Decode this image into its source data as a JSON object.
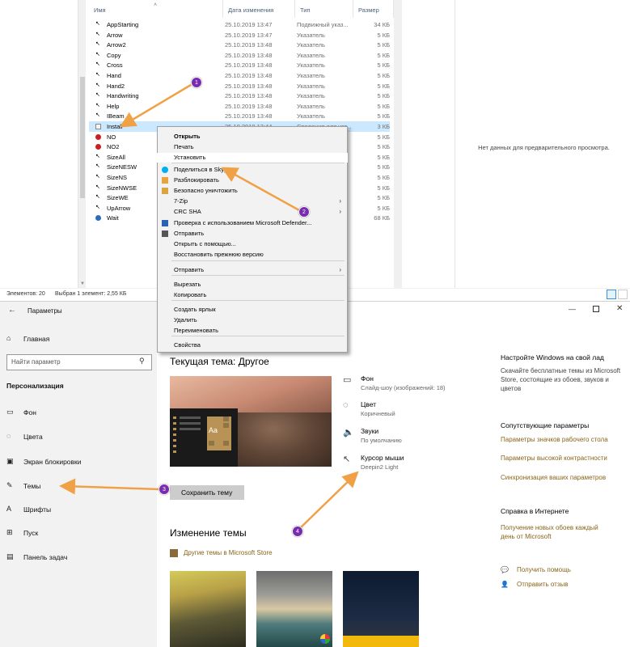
{
  "explorer": {
    "columns": {
      "name": "Имя",
      "date": "Дата изменения",
      "type": "Тип",
      "size": "Размер"
    },
    "files": [
      {
        "name": "AppStarting",
        "date": "25.10.2019 13:47",
        "type": "Подвижный указ...",
        "size": "34 КБ",
        "icon": "cursor-icon"
      },
      {
        "name": "Arrow",
        "date": "25.10.2019 13:47",
        "type": "Указатель",
        "size": "5 КБ",
        "icon": "cursor-icon"
      },
      {
        "name": "Arrow2",
        "date": "25.10.2019 13:48",
        "type": "Указатель",
        "size": "5 КБ",
        "icon": "cursor-icon"
      },
      {
        "name": "Copy",
        "date": "25.10.2019 13:48",
        "type": "Указатель",
        "size": "5 КБ",
        "icon": "cursor-icon"
      },
      {
        "name": "Cross",
        "date": "25.10.2019 13:48",
        "type": "Указатель",
        "size": "5 КБ",
        "icon": "cross-icon"
      },
      {
        "name": "Hand",
        "date": "25.10.2019 13:48",
        "type": "Указатель",
        "size": "5 КБ",
        "icon": "hand-icon"
      },
      {
        "name": "Hand2",
        "date": "25.10.2019 13:48",
        "type": "Указатель",
        "size": "5 КБ",
        "icon": "hand-icon"
      },
      {
        "name": "Handwriting",
        "date": "25.10.2019 13:48",
        "type": "Указатель",
        "size": "5 КБ",
        "icon": "pen-icon"
      },
      {
        "name": "Help",
        "date": "25.10.2019 13:48",
        "type": "Указатель",
        "size": "5 КБ",
        "icon": "cursor-icon"
      },
      {
        "name": "IBeam",
        "date": "25.10.2019 13:48",
        "type": "Указатель",
        "size": "5 КБ",
        "icon": "ibeam-icon"
      },
      {
        "name": "Install",
        "date": "25.10.2019 13:44",
        "type": "Сведения для уст...",
        "size": "3 КБ",
        "icon": "settings-file-icon"
      },
      {
        "name": "NO",
        "date": "",
        "type": "",
        "size": "5 КБ",
        "icon": "no-icon"
      },
      {
        "name": "NO2",
        "date": "",
        "type": "",
        "size": "5 КБ",
        "icon": "no-icon"
      },
      {
        "name": "SizeAll",
        "date": "",
        "type": "",
        "size": "5 КБ",
        "icon": "move-icon"
      },
      {
        "name": "SizeNESW",
        "date": "",
        "type": "",
        "size": "5 КБ",
        "icon": "resize-icon"
      },
      {
        "name": "SizeNS",
        "date": "",
        "type": "",
        "size": "5 КБ",
        "icon": "resize-icon"
      },
      {
        "name": "SizeNWSE",
        "date": "",
        "type": "",
        "size": "5 КБ",
        "icon": "resize-icon"
      },
      {
        "name": "SizeWE",
        "date": "",
        "type": "",
        "size": "5 КБ",
        "icon": "resize-icon"
      },
      {
        "name": "UpArrow",
        "date": "",
        "type": "",
        "size": "5 КБ",
        "icon": "cursor-icon"
      },
      {
        "name": "Wait",
        "date": "",
        "type": "",
        "size": "68 КБ",
        "icon": "wait-icon"
      }
    ],
    "selected_index": 10,
    "preview_message": "Нет данных для предварительного просмотра.",
    "status": {
      "count": "Элементов: 20",
      "selection": "Выбран 1 элемент: 2,55 КБ"
    }
  },
  "context_menu": {
    "items": [
      {
        "label": "Открыть",
        "bold": true
      },
      {
        "label": "Печать"
      },
      {
        "label": "Установить",
        "hover": true
      },
      {
        "label": "Поделиться в Skype",
        "icon": "skype-icon"
      },
      {
        "label": "Разблокировать",
        "icon": "unlock-icon"
      },
      {
        "label": "Безопасно уничтожить",
        "icon": "shred-icon"
      },
      {
        "label": "7-Zip",
        "submenu": true
      },
      {
        "label": "CRC SHA",
        "submenu": true
      },
      {
        "label": "Проверка с использованием Microsoft Defender...",
        "icon": "defender-icon"
      },
      {
        "label": "Отправить",
        "icon": "share-icon"
      },
      {
        "label": "Открыть с помощью..."
      },
      {
        "label": "Восстановить прежнюю версию"
      },
      {
        "label": "Отправить",
        "submenu": true
      },
      {
        "label": "Вырезать"
      },
      {
        "label": "Копировать"
      },
      {
        "label": "Создать ярлык"
      },
      {
        "label": "Удалить"
      },
      {
        "label": "Переименовать"
      },
      {
        "label": "Свойства"
      }
    ]
  },
  "settings": {
    "title": "Параметры",
    "home": "Главная",
    "search_placeholder": "Найти параметр",
    "section": "Персонализация",
    "nav": [
      {
        "label": "Фон",
        "icon": "image-icon"
      },
      {
        "label": "Цвета",
        "icon": "palette-icon"
      },
      {
        "label": "Экран блокировки",
        "icon": "lockscreen-icon"
      },
      {
        "label": "Темы",
        "icon": "themes-icon",
        "active": true
      },
      {
        "label": "Шрифты",
        "icon": "font-icon"
      },
      {
        "label": "Пуск",
        "icon": "start-icon"
      },
      {
        "label": "Панель задач",
        "icon": "taskbar-icon"
      }
    ],
    "current_theme_title": "Текущая тема: Другое",
    "tile_label": "Aa",
    "save_theme": "Сохранить тему",
    "properties": [
      {
        "title": "Фон",
        "subtitle": "Слайд-шоу (изображений: 18)",
        "icon": "image-icon"
      },
      {
        "title": "Цвет",
        "subtitle": "Коричневый",
        "icon": "palette-icon"
      },
      {
        "title": "Звуки",
        "subtitle": "По умолчанию",
        "icon": "speaker-icon"
      },
      {
        "title": "Курсор мыши",
        "subtitle": "Deepin2 Light",
        "icon": "cursor-icon"
      }
    ],
    "change_theme_title": "Изменение темы",
    "store_link": "Другие темы в Microsoft Store",
    "right": {
      "setup_head": "Настройте Windows на свой лад",
      "setup_text": "Скачайте бесплатные темы из Microsoft Store, состоящие из обоев, звуков и цветов",
      "related_head": "Сопутствующие параметры",
      "related_links": [
        "Параметры значков рабочего стола",
        "Параметры высокой контрастности",
        "Синхронизация ваших параметров"
      ],
      "help_head": "Справка в Интернете",
      "help_link": "Получение новых обоев каждый день от Microsoft",
      "get_help": "Получить помощь",
      "feedback": "Отправить отзыв"
    }
  },
  "annotations": {
    "badges": [
      "1",
      "2",
      "3",
      "4"
    ],
    "arrow_color": "#f0a146",
    "badge_color": "#7a2cb0"
  },
  "colors": {
    "accent": "#8a6418",
    "selection": "#cce8ff"
  }
}
